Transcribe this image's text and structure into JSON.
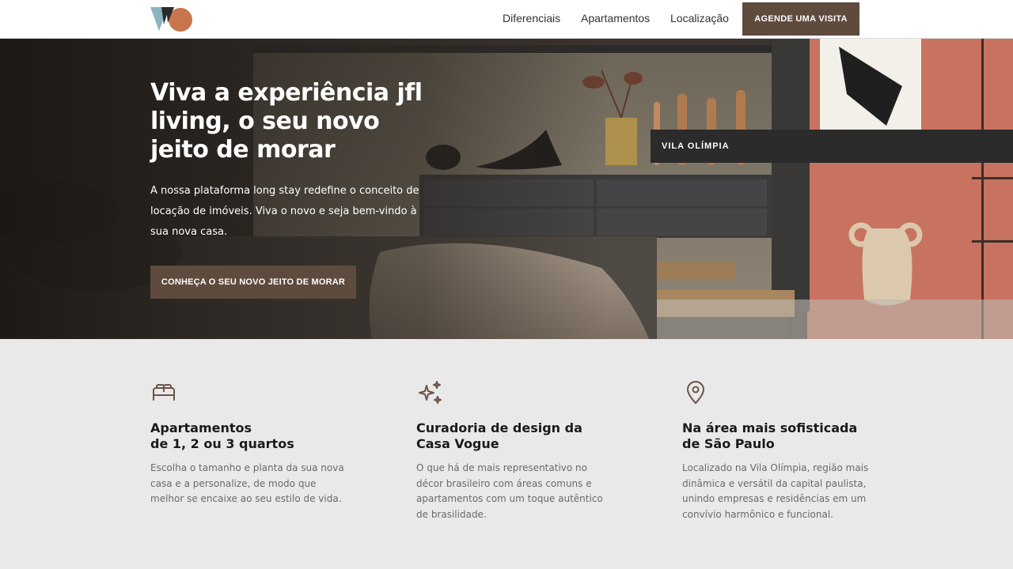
{
  "header": {
    "logo_name": "jfl-living-logo",
    "nav": [
      "Diferenciais",
      "Apartamentos",
      "Localização"
    ],
    "cta": "AGENDE UMA VISITA"
  },
  "hero": {
    "title": "Viva a experiência jfl living, o seu novo jeito de morar",
    "text": "A nossa plataforma long stay redefine o conceito de locação de imóveis. Viva o novo e seja bem-vindo à sua nova casa.",
    "cta": "CONHEÇA O SEU NOVO JEITO DE MORAR",
    "location": "VILA OLÍMPIA"
  },
  "features": [
    {
      "icon": "bed-icon",
      "title_line1": "Apartamentos",
      "title_line2": "de 1, 2 ou 3 quartos",
      "text": "Escolha o tamanho e planta da sua nova casa e a personalize, de modo que melhor se encaixe ao seu estilo de vida."
    },
    {
      "icon": "sparkles-icon",
      "title_line1": "Curadoria de design da",
      "title_line2": "Casa Vogue",
      "text": "O que há de mais representativo no décor brasileiro com áreas comuns e apartamentos com um toque autêntico de brasilidade."
    },
    {
      "icon": "location-pin-icon",
      "title_line1": "Na área mais sofisticada",
      "title_line2": "de São Paulo",
      "text": "Localizado na Vila Olímpia, região mais dinâmica e versátil da capital paulista, unindo empresas e residências em um convívio harmônico e funcional."
    }
  ],
  "colors": {
    "accent": "#5f4a3e",
    "dark_tag": "#2b2b2b",
    "section_bg": "#e9e9e9",
    "icon_color": "#6b5346"
  }
}
